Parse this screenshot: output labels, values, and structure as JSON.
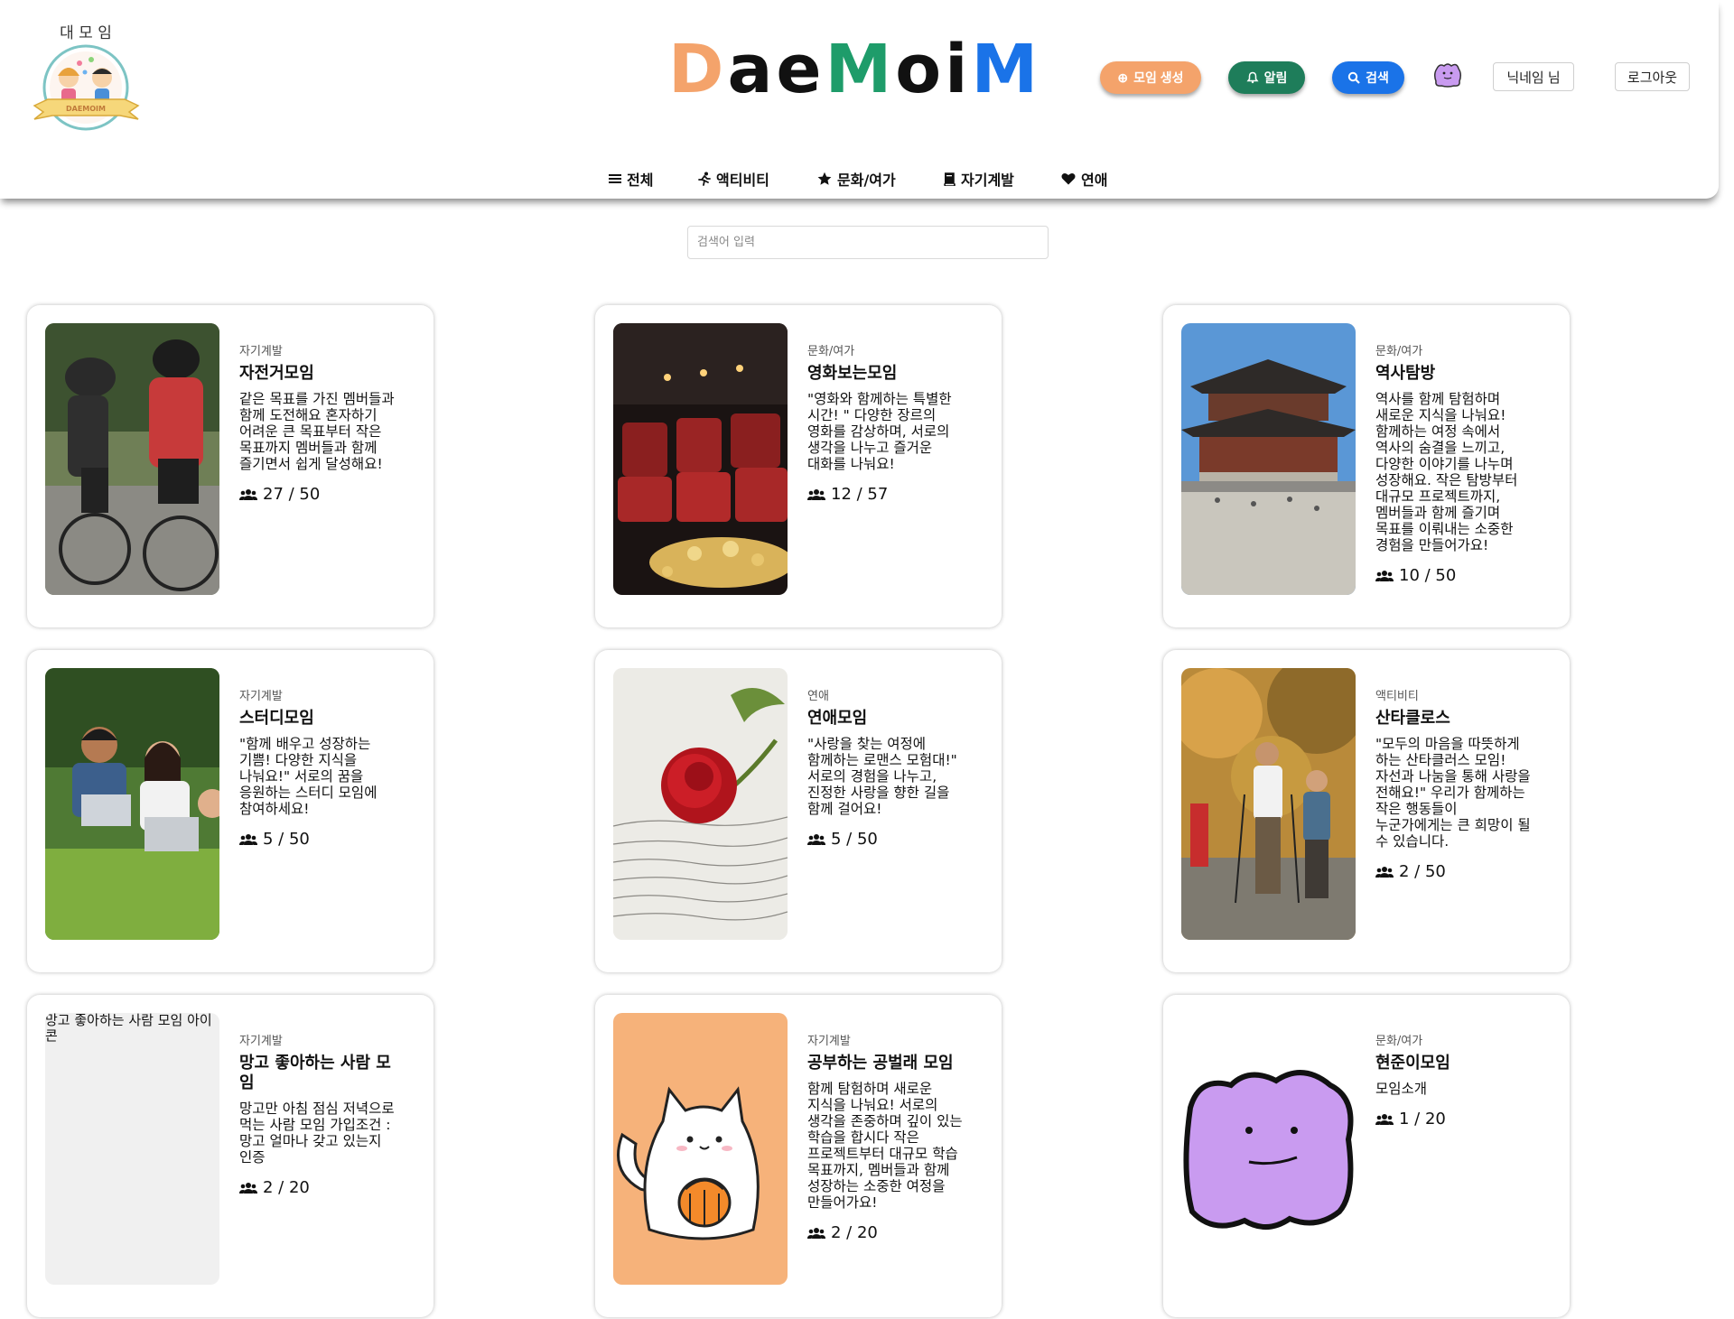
{
  "header": {
    "logo_small_text": "대 모 임",
    "logo_ribbon_text": "DAEMOIM",
    "brand": "DaeMoiM",
    "brand_colors": [
      "#f4a36b",
      "#111111",
      "#111111",
      "#1e9c6a",
      "#111111",
      "#111111",
      "#1a73e8"
    ],
    "btn_create": "모임 생성",
    "btn_alarm": "알림",
    "btn_search": "검색",
    "nickname": "닉네임 님",
    "logout": "로그아웃"
  },
  "nav": {
    "items": [
      {
        "label": "전체",
        "icon": "list-icon"
      },
      {
        "label": "액티비티",
        "icon": "running-icon"
      },
      {
        "label": "문화/여가",
        "icon": "star-icon"
      },
      {
        "label": "자기계발",
        "icon": "book-icon"
      },
      {
        "label": "연애",
        "icon": "heart-icon"
      }
    ]
  },
  "search": {
    "placeholder": "검색어 입력"
  },
  "cards": [
    {
      "category": "자기계발",
      "title": "자전거모임",
      "desc": "같은 목표를 가진 멤버들과 함께 도전해요 혼자하기 어려운 큰 목표부터 작은 목표까지 멤버들과 함께 즐기면서 쉽게 달성해요!",
      "count": "27 / 50",
      "image": "cyclists"
    },
    {
      "category": "문화/여가",
      "title": "영화보는모임",
      "desc": "\"영화와 함께하는 특별한 시간! \" 다양한 장르의 영화를 감상하며, 서로의 생각을 나누고 즐거운 대화를 나눠요!",
      "count": "12 / 57",
      "image": "cinema"
    },
    {
      "category": "문화/여가",
      "title": "역사탐방",
      "desc": "역사를 함께 탐험하며 새로운 지식을 나눠요! 함께하는 여정 속에서 역사의 숨결을 느끼고, 다양한 이야기를 나누며 성장해요. 작은 탐방부터 대규모 프로젝트까지, 멤버들과 함께 즐기며 목표를 이뤄내는 소중한 경험을 만들어가요!",
      "count": "10 / 50",
      "image": "palace"
    },
    {
      "category": "자기계발",
      "title": "스터디모임",
      "desc": "\"함께 배우고 성장하는 기쁨! 다양한 지식을 나눠요!\" 서로의 꿈을 응원하는 스터디 모임에 참여하세요!",
      "count": "5 / 50",
      "image": "study"
    },
    {
      "category": "연애",
      "title": "연애모임",
      "desc": "\"사랑을 찾는 여정에 함께하는 로맨스 모험대!\" 서로의 경험을 나누고, 진정한 사랑을 향한 길을 함께 걸어요!",
      "count": "5 / 50",
      "image": "rose"
    },
    {
      "category": "액티비티",
      "title": "산타클로스",
      "desc": "\"모두의 마음을 따뜻하게 하는 산타클러스 모임! 자선과 나눔을 통해 사랑을 전해요!\" 우리가 함께하는 작은 행동들이 누군가에게는 큰 희망이 될 수 있습니다.",
      "count": "2 / 50",
      "image": "hikers"
    },
    {
      "category": "자기계발",
      "title": "망고 좋아하는 사람 모임",
      "desc": "망고만 아침 점심 저녁으로 먹는 사람 모임 가입조건 : 망고 얼마나 갖고 있는지 인증",
      "count": "2 / 20",
      "image": "broken",
      "alt": "망고 좋아하는 사람 모임 아이콘"
    },
    {
      "category": "자기계발",
      "title": "공부하는 공벌래 모임",
      "desc": "함께 탐험하며 새로운 지식을 나눠요! 서로의 생각을 존중하며 깊이 있는 학습을 합시다 작은 프로젝트부터 대규모 학습 목표까지, 멤버들과 함께 성장하는 소중한 여정을 만들어가요!",
      "count": "2 / 20",
      "image": "cat"
    },
    {
      "category": "문화/여가",
      "title": "현준이모임",
      "desc": "모임소개",
      "count": "1 / 20",
      "image": "ditto"
    }
  ]
}
